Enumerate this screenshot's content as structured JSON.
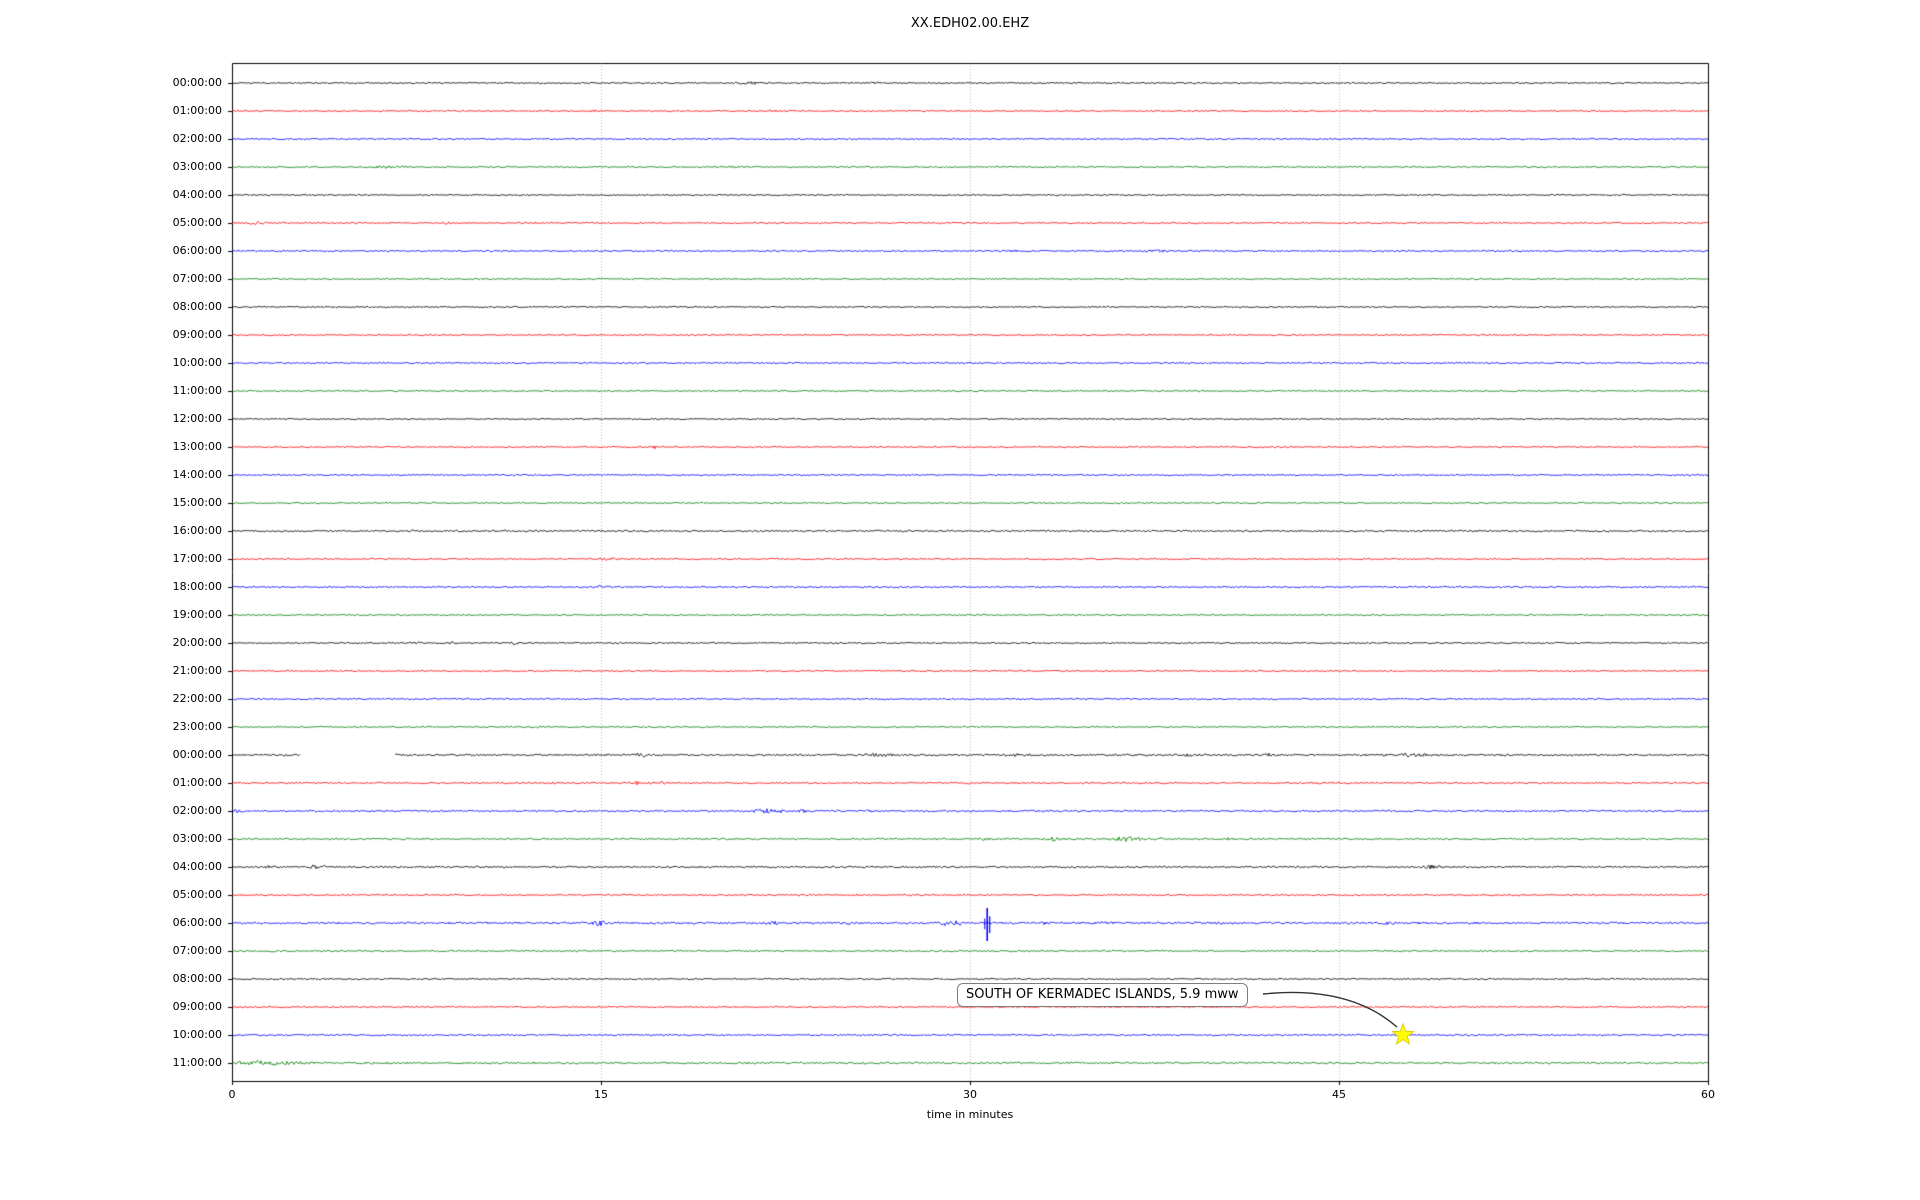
{
  "title": "XX.EDH02.00.EHZ",
  "chart_data": {
    "type": "line",
    "subtype": "seismogram-dayplot",
    "title": "XX.EDH02.00.EHZ",
    "xlabel": "time in minutes",
    "x_range": [
      0,
      60
    ],
    "x_ticks": [
      "0",
      "15",
      "30",
      "45",
      "60"
    ],
    "x_tick_values": [
      0,
      15,
      30,
      45,
      60
    ],
    "grid_minutes": [
      15,
      30,
      45
    ],
    "grid_style": "dotted-vertical",
    "color_cycle": [
      "#000000",
      "#ff0000",
      "#0000ff",
      "#008000"
    ],
    "rows": [
      {
        "label": "00:00:00",
        "color": "#000000",
        "noise": 0.7,
        "events": [
          [
            21,
            0.8,
            1.1
          ],
          [
            26,
            0.5,
            0.9
          ]
        ]
      },
      {
        "label": "01:00:00",
        "color": "#ff0000",
        "noise": 0.7,
        "events": [
          [
            14.7,
            0.3,
            0.9
          ],
          [
            22,
            0.3,
            0.8
          ]
        ]
      },
      {
        "label": "02:00:00",
        "color": "#0000ff",
        "noise": 0.7,
        "events": []
      },
      {
        "label": "03:00:00",
        "color": "#008000",
        "noise": 0.7,
        "events": [
          [
            6.5,
            1.0,
            1.0
          ],
          [
            20.5,
            0.4,
            0.9
          ]
        ]
      },
      {
        "label": "04:00:00",
        "color": "#000000",
        "noise": 0.65,
        "events": []
      },
      {
        "label": "05:00:00",
        "color": "#ff0000",
        "noise": 0.75,
        "events": [
          [
            0.8,
            0.8,
            1.3
          ],
          [
            4.7,
            0.3,
            1.1
          ],
          [
            8.8,
            0.3,
            1.0
          ],
          [
            12.2,
            0.3,
            0.9
          ]
        ]
      },
      {
        "label": "06:00:00",
        "color": "#0000ff",
        "noise": 0.7,
        "events": [
          [
            31.8,
            0.3,
            0.9
          ],
          [
            37.5,
            0.6,
            1.3
          ]
        ]
      },
      {
        "label": "07:00:00",
        "color": "#008000",
        "noise": 0.7,
        "events": []
      },
      {
        "label": "08:00:00",
        "color": "#000000",
        "noise": 0.65,
        "events": []
      },
      {
        "label": "09:00:00",
        "color": "#ff0000",
        "noise": 0.7,
        "events": []
      },
      {
        "label": "10:00:00",
        "color": "#0000ff",
        "noise": 0.75,
        "events": []
      },
      {
        "label": "11:00:00",
        "color": "#008000",
        "noise": 0.7,
        "events": []
      },
      {
        "label": "12:00:00",
        "color": "#000000",
        "noise": 0.65,
        "events": []
      },
      {
        "label": "13:00:00",
        "color": "#ff0000",
        "noise": 0.7,
        "events": [
          [
            17.2,
            0.2,
            1.4
          ]
        ]
      },
      {
        "label": "14:00:00",
        "color": "#0000ff",
        "noise": 0.7,
        "events": []
      },
      {
        "label": "15:00:00",
        "color": "#008000",
        "noise": 0.7,
        "events": []
      },
      {
        "label": "16:00:00",
        "color": "#000000",
        "noise": 0.85,
        "events": []
      },
      {
        "label": "17:00:00",
        "color": "#ff0000",
        "noise": 0.75,
        "events": [
          [
            15.3,
            0.4,
            1.0
          ]
        ]
      },
      {
        "label": "18:00:00",
        "color": "#0000ff",
        "noise": 0.75,
        "events": [
          [
            15.0,
            0.4,
            1.1
          ]
        ]
      },
      {
        "label": "19:00:00",
        "color": "#008000",
        "noise": 0.7,
        "events": []
      },
      {
        "label": "20:00:00",
        "color": "#000000",
        "noise": 0.7,
        "events": [
          [
            7.4,
            0.4,
            1.2
          ],
          [
            9.0,
            0.3,
            1.1
          ],
          [
            11.5,
            0.4,
            1.2
          ],
          [
            24.5,
            0.3,
            0.9
          ]
        ]
      },
      {
        "label": "21:00:00",
        "color": "#ff0000",
        "noise": 0.7,
        "events": []
      },
      {
        "label": "22:00:00",
        "color": "#0000ff",
        "noise": 0.75,
        "events": []
      },
      {
        "label": "23:00:00",
        "color": "#008000",
        "noise": 0.7,
        "events": [
          [
            12.5,
            0.2,
            1.2
          ]
        ]
      },
      {
        "label": "00:00:00",
        "color": "#000000",
        "noise": 0.9,
        "gap": [
          2.8,
          6.6
        ],
        "events": [
          [
            16.6,
            0.5,
            1.2
          ],
          [
            26.2,
            0.8,
            1.1
          ],
          [
            32,
            0.5,
            1.1
          ],
          [
            39.1,
            0.6,
            1.1
          ],
          [
            42.1,
            0.5,
            1.1
          ],
          [
            47.9,
            0.8,
            1.5
          ]
        ]
      },
      {
        "label": "01:00:00",
        "color": "#ff0000",
        "noise": 0.8,
        "events": [
          [
            13,
            0.2,
            0.9
          ],
          [
            16.4,
            0.3,
            1.6
          ],
          [
            17.1,
            0.2,
            1.5
          ],
          [
            17.5,
            0.2,
            1.3
          ],
          [
            29.9,
            0.12,
            2.2
          ]
        ]
      },
      {
        "label": "02:00:00",
        "color": "#0000ff",
        "noise": 0.85,
        "events": [
          [
            0.3,
            0.4,
            2.2
          ],
          [
            21.6,
            0.5,
            2.6
          ],
          [
            22.4,
            0.2,
            1.7
          ],
          [
            23.2,
            0.3,
            1.5
          ],
          [
            25.8,
            0.2,
            1.1
          ]
        ]
      },
      {
        "label": "03:00:00",
        "color": "#008000",
        "noise": 0.85,
        "events": [
          [
            30.6,
            0.3,
            1.3
          ],
          [
            33.4,
            0.3,
            1.8
          ],
          [
            36.3,
            0.5,
            2.6
          ],
          [
            36.9,
            0.3,
            2.0
          ],
          [
            37.8,
            0.3,
            2.0
          ],
          [
            40.5,
            0.2,
            1.1
          ]
        ]
      },
      {
        "label": "04:00:00",
        "color": "#000000",
        "noise": 0.85,
        "events": [
          [
            1.5,
            0.4,
            1.4
          ],
          [
            3.3,
            0.25,
            2.8
          ],
          [
            3.7,
            0.15,
            1.4
          ],
          [
            48.7,
            0.3,
            2.4
          ],
          [
            49.1,
            0.15,
            1.4
          ]
        ]
      },
      {
        "label": "05:00:00",
        "color": "#ff0000",
        "noise": 0.8,
        "events": [
          [
            25.3,
            0.15,
            1.4
          ]
        ]
      },
      {
        "label": "06:00:00",
        "color": "#0000ff",
        "noise": 1.0,
        "events": [
          [
            14.9,
            0.3,
            2.8
          ],
          [
            22,
            0.3,
            1.2
          ],
          [
            25,
            0.3,
            1.1
          ],
          [
            28.9,
            0.4,
            1.9
          ],
          [
            29.5,
            0.3,
            1.7
          ],
          [
            33,
            0.3,
            1.1
          ],
          [
            35.5,
            0.3,
            1.2
          ],
          [
            40,
            0.3,
            1.0
          ],
          [
            47,
            0.3,
            1.1
          ]
        ],
        "spikes": [
          [
            30.7,
            15,
            18
          ]
        ]
      },
      {
        "label": "07:00:00",
        "color": "#008000",
        "noise": 0.75,
        "events": [
          [
            1.7,
            0.2,
            1.6
          ]
        ]
      },
      {
        "label": "08:00:00",
        "color": "#000000",
        "noise": 0.7,
        "events": []
      },
      {
        "label": "09:00:00",
        "color": "#ff0000",
        "noise": 0.75,
        "events": []
      },
      {
        "label": "10:00:00",
        "color": "#0000ff",
        "noise": 0.8,
        "events": []
      },
      {
        "label": "11:00:00",
        "color": "#008000",
        "noise": 0.95,
        "events": [
          [
            0.5,
            0.3,
            2.8
          ],
          [
            1.0,
            0.5,
            1.9
          ],
          [
            1.8,
            0.6,
            1.4
          ],
          [
            2.6,
            0.5,
            1.1
          ]
        ]
      }
    ],
    "annotation": {
      "text": "SOUTH OF KERMADEC ISLANDS, 5.9 mww",
      "row_index": 34,
      "row_label": "10:00:00",
      "minute": 47.6,
      "marker": "star",
      "marker_color": "#ffff00",
      "marker_edge_color": "#e0d000"
    }
  }
}
